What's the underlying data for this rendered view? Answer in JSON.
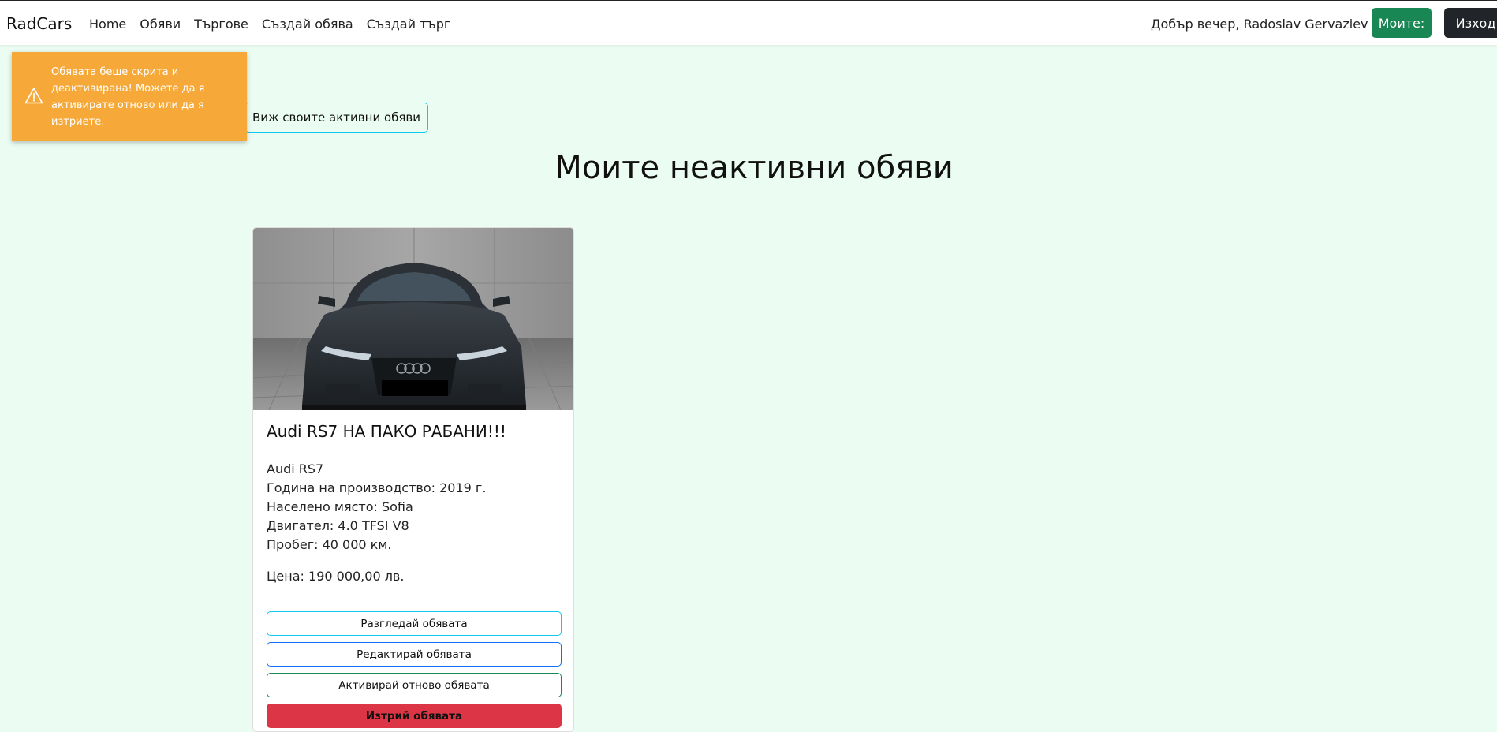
{
  "navbar": {
    "brand": "RadCars",
    "links": [
      "Home",
      "Обяви",
      "Търгове",
      "Създай обява",
      "Създай търг"
    ],
    "greeting": "Добър вечер, Radoslav Gervaziev",
    "mine_label": "Моите:",
    "logout_label": "Изход"
  },
  "toast": {
    "icon": "warning-triangle-icon",
    "message": "Обявата беше скрита и деактивирана! Можете да я активирате отново или да я изтриете.",
    "color": "#f6a938"
  },
  "active_listings_button": "Виж своите активни обяви",
  "page_title": "Моите неактивни обяви",
  "listing": {
    "title": "Audi RS7 НА ПАКО РАБАНИ!!!",
    "model": "Audi RS7",
    "year": "Година на производство: 2019 г.",
    "location": "Населено място: Sofia",
    "engine": "Двигател: 4.0 TFSI V8",
    "mileage": "Пробег: 40 000 км.",
    "price": "Цена: 190 000,00 лв.",
    "buttons": {
      "view": "Разгледай обявата",
      "edit": "Редактирай обявата",
      "reactivate": "Активирай отново обявата",
      "delete": "Изтрий обявата"
    }
  },
  "colors": {
    "page_background": "#ebfdf2",
    "success": "#198754",
    "dark": "#212529",
    "danger": "#dc3545",
    "info": "#0dcaf0",
    "primary": "#0d6efd"
  }
}
